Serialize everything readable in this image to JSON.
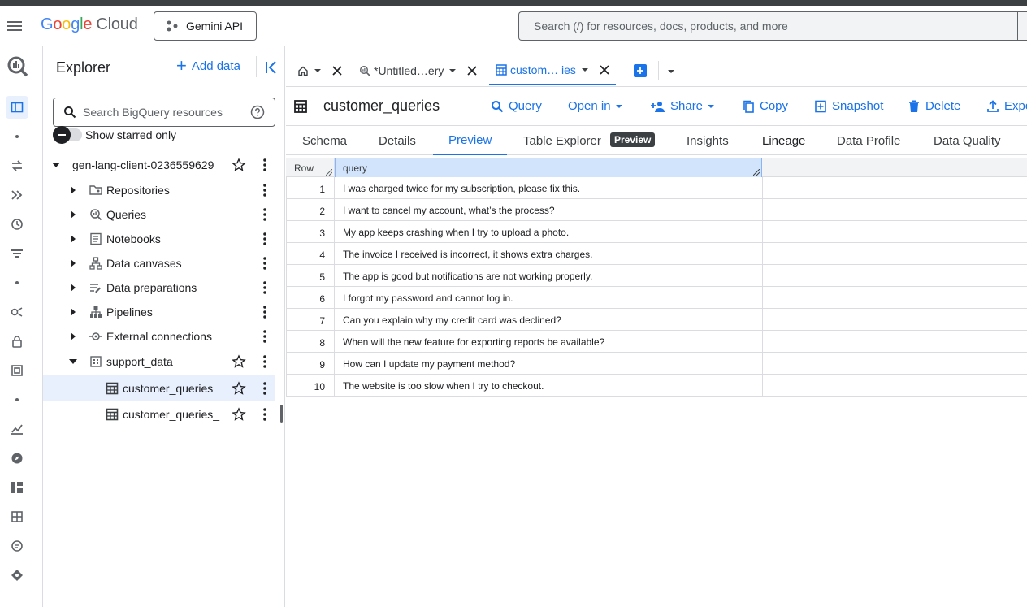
{
  "header": {
    "logo_letters": [
      "G",
      "o",
      "o",
      "g",
      "l",
      "e"
    ],
    "logo_product": "Cloud",
    "project_button": "Gemini API",
    "search_placeholder": "Search (/) for resources, docs, products, and more"
  },
  "explorer": {
    "title": "Explorer",
    "add_data": "Add data",
    "search_placeholder": "Search BigQuery resources",
    "show_starred": "Show starred only",
    "project": "gen-lang-client-0236559629",
    "items": [
      {
        "label": "Repositories",
        "icon": "repository-icon"
      },
      {
        "label": "Queries",
        "icon": "queries-icon"
      },
      {
        "label": "Notebooks",
        "icon": "notebook-icon"
      },
      {
        "label": "Data canvases",
        "icon": "canvas-icon"
      },
      {
        "label": "Data preparations",
        "icon": "data-prep-icon"
      },
      {
        "label": "Pipelines",
        "icon": "pipeline-icon"
      },
      {
        "label": "External connections",
        "icon": "connection-icon"
      }
    ],
    "dataset": "support_data",
    "tables": [
      "customer_queries",
      "customer_queries_"
    ]
  },
  "tabs": [
    {
      "label": "",
      "icon": "home-icon"
    },
    {
      "label": "*Untitled…ery",
      "icon": "query-icon"
    },
    {
      "label": "custom… ies",
      "icon": "table-icon",
      "active": true
    }
  ],
  "toolbar": {
    "table_name": "customer_queries",
    "query": "Query",
    "open_in": "Open in",
    "share": "Share",
    "copy": "Copy",
    "snapshot": "Snapshot",
    "delete": "Delete",
    "export": "Expo"
  },
  "subtabs": {
    "schema": "Schema",
    "details": "Details",
    "preview": "Preview",
    "table_explorer": "Table Explorer",
    "badge": "Preview",
    "insights": "Insights",
    "lineage": "Lineage",
    "data_profile": "Data Profile",
    "data_quality": "Data Quality"
  },
  "grid": {
    "columns": [
      "Row",
      "query"
    ],
    "rows": [
      {
        "num": "1",
        "query": "I was charged twice for my subscription, please fix this."
      },
      {
        "num": "2",
        "query": "I want to cancel my account, what’s the process?"
      },
      {
        "num": "3",
        "query": "My app keeps crashing when I try to upload a photo."
      },
      {
        "num": "4",
        "query": "The invoice I received is incorrect, it shows extra charges."
      },
      {
        "num": "5",
        "query": "The app is good but notifications are not working properly."
      },
      {
        "num": "6",
        "query": "I forgot my password and cannot log in."
      },
      {
        "num": "7",
        "query": "Can you explain why my credit card was declined?"
      },
      {
        "num": "8",
        "query": "When will the new feature for exporting reports be available?"
      },
      {
        "num": "9",
        "query": "How can I update my payment method?"
      },
      {
        "num": "10",
        "query": "The website is too slow when I try to checkout."
      }
    ]
  },
  "colors": {
    "accent": "#1a73e8",
    "selected_bg": "#e8f0fe",
    "header_col_bg": "#d2e3fc"
  }
}
